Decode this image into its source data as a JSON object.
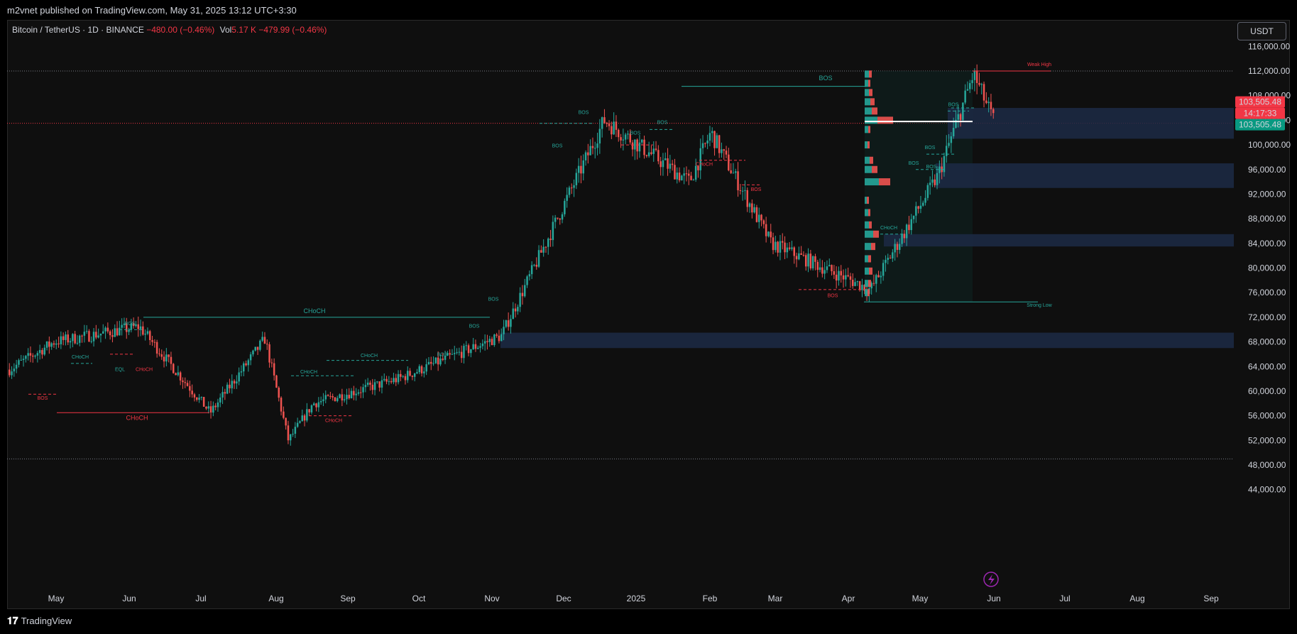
{
  "header": {
    "publisher": "m2vnet published on TradingView.com, May 31, 2025 13:12 UTC+3:30"
  },
  "legend": {
    "symbol": "Bitcoin / TetherUS · 1D · BINANCE",
    "change": "−480.00 (−0.46%)",
    "vol_label": "Vol",
    "vol_value": "5.17 K",
    "vol_change": "−479.99 (−0.46%)"
  },
  "currency_button": "USDT",
  "footer": {
    "brand": "TradingView",
    "logo_glyph": "𝟏𝟕"
  },
  "price_badges": {
    "last_price": "103,505.48",
    "countdown": "14:17:33",
    "last_price_green": "103,505.48"
  },
  "colors": {
    "bull": "#26a69a",
    "bear": "#ef5350",
    "zone": "#1c2a45",
    "bos_green": "#26a69a",
    "bos_red": "#f23645"
  },
  "chart_data": {
    "type": "candlestick",
    "symbol": "BTCUSDT",
    "timeframe": "1D",
    "x_ticks": [
      "May",
      "Jun",
      "Jul",
      "Aug",
      "Sep",
      "Oct",
      "Nov",
      "Dec",
      "2025",
      "Feb",
      "Mar",
      "Apr",
      "May",
      "Jun",
      "Jul",
      "Aug",
      "Sep"
    ],
    "y_ticks": [
      "116,000.00",
      "112,000.00",
      "108,000.00",
      "104,000.00",
      "100,000.00",
      "96,000.00",
      "92,000.00",
      "88,000.00",
      "84,000.00",
      "80,000.00",
      "76,000.00",
      "72,000.00",
      "68,000.00",
      "64,000.00",
      "60,000.00",
      "56,000.00",
      "52,000.00",
      "48,000.00",
      "44,000.00"
    ],
    "ylim": [
      41000,
      119500
    ],
    "path_anchors": [
      {
        "month": "May 2024",
        "price": 63500
      },
      {
        "month": "late May 2024",
        "price": 68000
      },
      {
        "month": "Jun 2024",
        "price": 70500
      },
      {
        "month": "Jul 2024",
        "price": 56500
      },
      {
        "month": "late Jul 2024",
        "price": 68500
      },
      {
        "month": "Aug 2024",
        "price": 52000
      },
      {
        "month": "Sep 2024",
        "price": 58000
      },
      {
        "month": "Oct 2024",
        "price": 62000
      },
      {
        "month": "Nov 2024",
        "price": 69000
      },
      {
        "month": "Dec 2024",
        "price": 104000
      },
      {
        "month": "2025",
        "price": 94000
      },
      {
        "month": "Feb 2025",
        "price": 102000
      },
      {
        "month": "Mar 2025",
        "price": 84000
      },
      {
        "month": "Apr 2025",
        "price": 76500
      },
      {
        "month": "May 2025",
        "price": 95000
      },
      {
        "month": "late May 2025",
        "price": 111500
      },
      {
        "month": "end May 2025",
        "price": 103505
      }
    ],
    "last_price": 103505.48,
    "horizontal_levels": [
      112000,
      49000,
      103505.48
    ],
    "zones": [
      {
        "from": 101000,
        "to": 106000
      },
      {
        "from": 93000,
        "to": 97000
      },
      {
        "from": 83500,
        "to": 85500
      },
      {
        "from": 67000,
        "to": 69500
      }
    ],
    "annotations": [
      {
        "text": "BOS",
        "color": "green"
      },
      {
        "text": "Weak High",
        "color": "red"
      },
      {
        "text": "Strong Low",
        "color": "green"
      },
      {
        "text": "CHoCH",
        "color": "green"
      },
      {
        "text": "CHoCH",
        "color": "red"
      },
      {
        "text": "BOS",
        "color": "red"
      },
      {
        "text": "EQL",
        "color": "green"
      }
    ]
  }
}
